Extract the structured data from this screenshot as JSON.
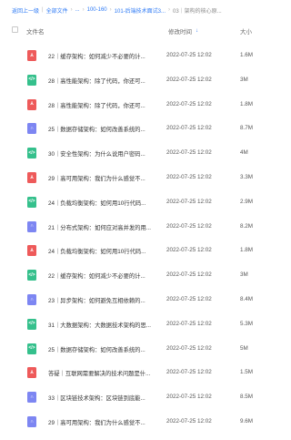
{
  "breadcrumb": {
    "back": "返回上一级",
    "all_files": "全部文件",
    "ellipsis": "...",
    "folder1": "100-160",
    "folder2": "101-后端技术面试3...",
    "current": "03｜架构的核心原..."
  },
  "header": {
    "name": "文件名",
    "time": "修改时间",
    "size": "大小",
    "sort_icon": "↓"
  },
  "icon_glyphs": {
    "pdf": "⅄",
    "epub": "</>",
    "audio": "∩"
  },
  "rows": [
    {
      "type": "pdf",
      "name": "22｜缓存架构：如何减少不必要的计...",
      "time": "2022-07-25 12:02",
      "size": "1.6M"
    },
    {
      "type": "epub",
      "name": "28｜高性能架构：除了代码，你还可...",
      "time": "2022-07-25 12:02",
      "size": "3M"
    },
    {
      "type": "pdf",
      "name": "28｜高性能架构：除了代码，你还可...",
      "time": "2022-07-25 12:02",
      "size": "1.8M"
    },
    {
      "type": "audio",
      "name": "25｜数据存储架构：如何改善系统的...",
      "time": "2022-07-25 12:02",
      "size": "8.7M"
    },
    {
      "type": "epub",
      "name": "30｜安全性架构：为什么说用户密码...",
      "time": "2022-07-25 12:02",
      "size": "4M"
    },
    {
      "type": "pdf",
      "name": "29｜高可用架构：我们为什么感觉不...",
      "time": "2022-07-25 12:02",
      "size": "3.3M"
    },
    {
      "type": "epub",
      "name": "24｜负载均衡架构：如何用10行代码...",
      "time": "2022-07-25 12:02",
      "size": "2.9M"
    },
    {
      "type": "audio",
      "name": "21｜分布式架构：如何应对高并发的用...",
      "time": "2022-07-25 12:02",
      "size": "8.2M"
    },
    {
      "type": "pdf",
      "name": "24｜负载均衡架构：如何用10行代码...",
      "time": "2022-07-25 12:02",
      "size": "1.8M"
    },
    {
      "type": "epub",
      "name": "22｜缓存架构：如何减少不必要的计...",
      "time": "2022-07-25 12:02",
      "size": "3M"
    },
    {
      "type": "audio",
      "name": "23｜异步架构：如何避免互相依赖的...",
      "time": "2022-07-25 12:02",
      "size": "8.4M"
    },
    {
      "type": "epub",
      "name": "31｜大数据架构：大数据技术架构的思...",
      "time": "2022-07-25 12:02",
      "size": "5.3M"
    },
    {
      "type": "epub",
      "name": "25｜数据存储架构：如何改善系统的...",
      "time": "2022-07-25 12:02",
      "size": "5M"
    },
    {
      "type": "pdf",
      "name": "答疑｜互联网需要解决的技术问题是什...",
      "time": "2022-07-25 12:02",
      "size": "1.5M"
    },
    {
      "type": "audio",
      "name": "33｜区块链技术架构：区块链到底能...",
      "time": "2022-07-25 12:02",
      "size": "8.5M"
    },
    {
      "type": "audio",
      "name": "29｜高可用架构：我们为什么感觉不...",
      "time": "2022-07-25 12:02",
      "size": "9.6M"
    }
  ]
}
